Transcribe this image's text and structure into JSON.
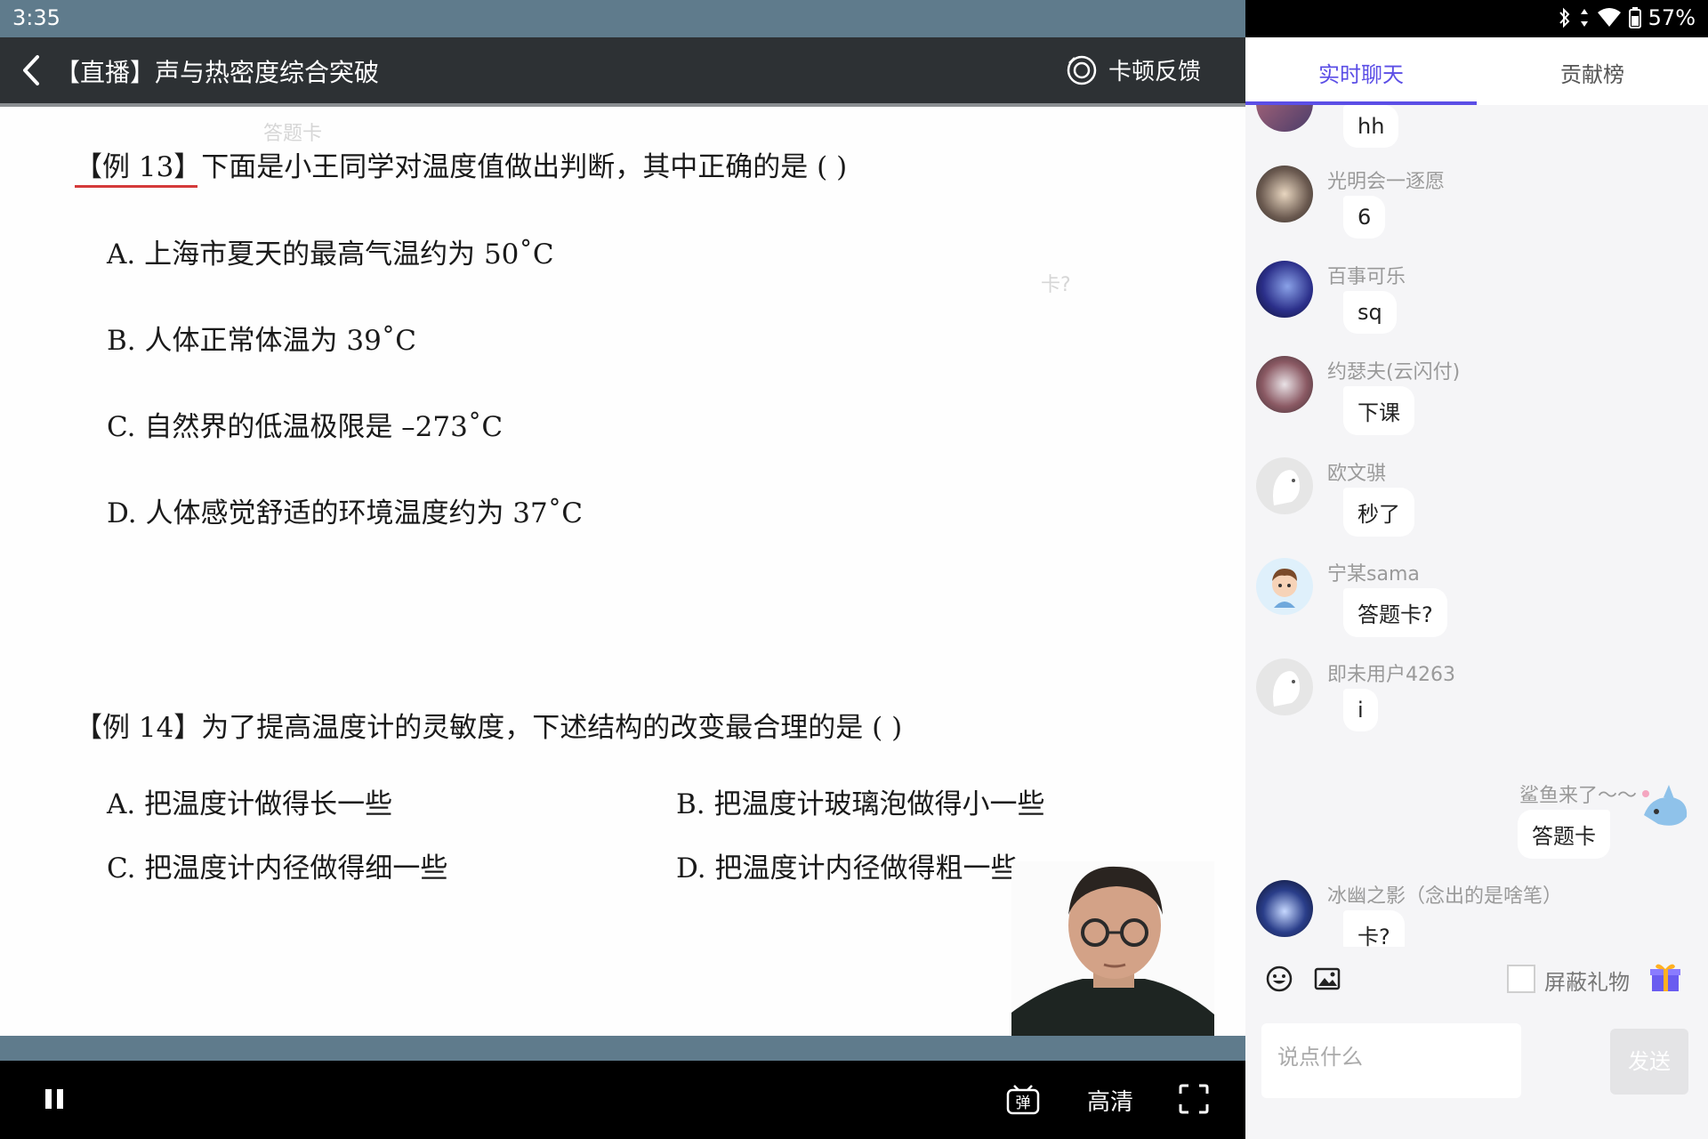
{
  "status_bar": {
    "time": "3:35",
    "battery": "57%"
  },
  "header": {
    "title": "【直播】声与热密度综合突破",
    "feedback_label": "卡顿反馈"
  },
  "slide": {
    "ghost_answer_card": "答题卡",
    "ghost_stuck": "卡?",
    "q13": {
      "stem": "【例 13】下面是小王同学对温度值做出判断，其中正确的是 (        )",
      "options": [
        "A.  上海市夏天的最高气温约为 50˚C",
        "B.  人体正常体温为 39˚C",
        "C.  自然界的低温极限是 –273˚C",
        "D.  人体感觉舒适的环境温度约为 37˚C"
      ]
    },
    "q14": {
      "stem": "【例 14】为了提高温度计的灵敏度，下述结构的改变最合理的是 (        )",
      "options": [
        "A.  把温度计做得长一些",
        "B.  把温度计玻璃泡做得小一些",
        "C.  把温度计内径做得细一些",
        "D.  把温度计内径做得粗一些"
      ]
    }
  },
  "controls": {
    "danmu_label": "弹",
    "quality_label": "高清"
  },
  "chat": {
    "tabs": [
      "实时聊天",
      "贡献榜"
    ],
    "messages": [
      {
        "user": "",
        "text": "hh"
      },
      {
        "user": "光明会一逐愿",
        "text": "6"
      },
      {
        "user": "百事可乐",
        "text": "sq"
      },
      {
        "user": "约瑟夫(云闪付)",
        "text": "下课"
      },
      {
        "user": "欧文骐",
        "text": "秒了"
      },
      {
        "user": "宁某sama",
        "text": "答题卡?"
      },
      {
        "user": "即未用户4263",
        "text": "i"
      },
      {
        "user": "鲨鱼来了～～",
        "text": "答题卡"
      },
      {
        "user": "冰幽之影（念出的是啥笔）",
        "text": "卡?"
      }
    ],
    "block_gifts_label": "屏蔽礼物",
    "input_placeholder": "说点什么",
    "send_label": "发送"
  },
  "colors": {
    "accent": "#5b4ee6",
    "header_bg": "#2d3134",
    "strip": "#5f7b8c"
  }
}
